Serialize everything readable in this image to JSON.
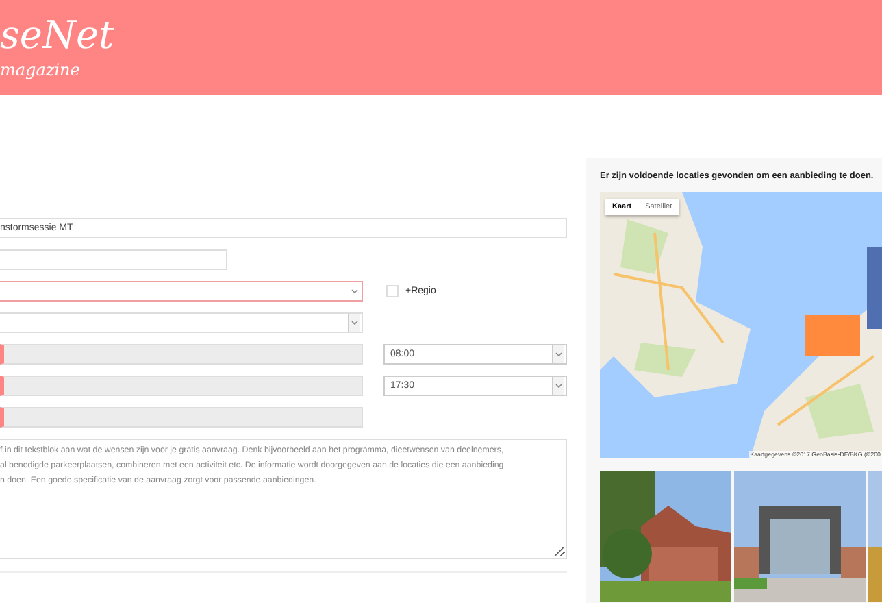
{
  "header": {
    "logo": "seNet",
    "tagline": "magazine"
  },
  "form": {
    "name_value": "nstormsessie MT",
    "region_select": {
      "invalid": true
    },
    "regio_checkbox": {
      "label": "+Regio",
      "checked": false
    },
    "date_fields": [
      {
        "invalid": true,
        "time": "08:00"
      },
      {
        "invalid": true,
        "time": "17:30"
      },
      {
        "invalid": true
      }
    ],
    "wishes": {
      "placeholder": "f in dit tekstblok aan wat de wensen zijn voor je gratis aanvraag. Denk bijvoorbeeld aan het programma, dieetwensen van deelnemers,\nal benodigde parkeerplaatsen, combineren met een activiteit etc. De informatie wordt doorgegeven aan de locaties die een aanbieding\nn doen. Een goede specificatie van de aanvraag zorgt voor passende aanbiedingen."
    }
  },
  "sidebar": {
    "message": "Er zijn voldoende locaties gevonden om een aanbieding te doen.",
    "map_tabs": [
      {
        "label": "Kaart",
        "selected": true
      },
      {
        "label": "Satelliet",
        "selected": false
      }
    ],
    "map_attribution": "Kaartgegevens ©2017 GeoBasis-DE/BKG (©200"
  }
}
